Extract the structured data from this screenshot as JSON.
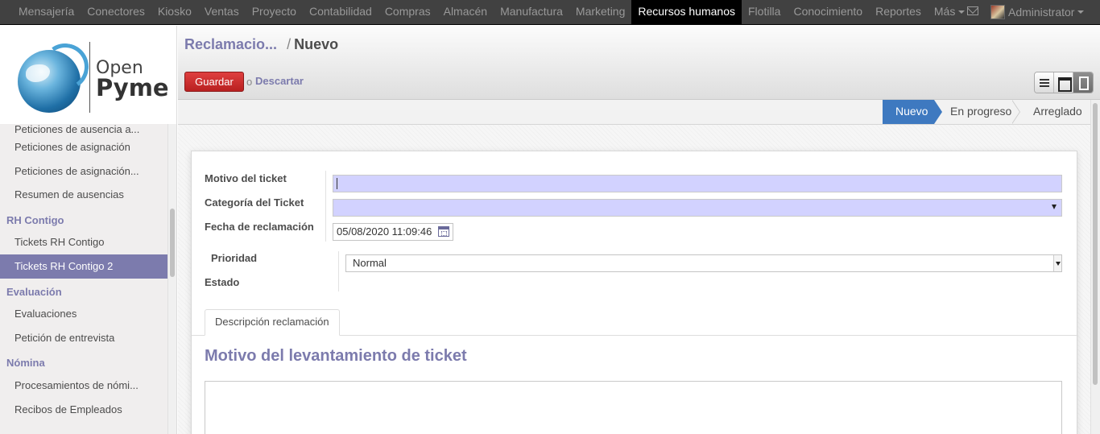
{
  "topnav": {
    "items": [
      "Mensajería",
      "Conectores",
      "Kiosko",
      "Ventas",
      "Proyecto",
      "Contabilidad",
      "Compras",
      "Almacén",
      "Manufactura",
      "Marketing",
      "Recursos humanos",
      "Flotilla",
      "Conocimiento",
      "Reportes",
      "Más"
    ],
    "active_index": 10,
    "user": "Administrator"
  },
  "logo": {
    "line1": "Open",
    "line2": "Pyme"
  },
  "sidebar": {
    "cut_item": "Peticiones de ausencia a...",
    "items_a": [
      "Peticiones de asignación",
      "Peticiones de asignación...",
      "Resumen de ausencias"
    ],
    "head_rh": "RH Contigo",
    "items_rh": [
      "Tickets RH Contigo",
      "Tickets RH Contigo 2"
    ],
    "head_eval": "Evaluación",
    "items_eval": [
      "Evaluaciones",
      "Petición de entrevista"
    ],
    "head_nomina": "Nómina",
    "items_nomina": [
      "Procesamientos de nómi...",
      "Recibos de Empleados"
    ]
  },
  "header": {
    "breadcrumb_parent": "Reclamacio...",
    "breadcrumb_sep": "/",
    "breadcrumb_current": "Nuevo",
    "save_label": "Guardar",
    "or_label": "o",
    "discard_label": "Descartar"
  },
  "stages": [
    "Nuevo",
    "En progreso",
    "Arreglado"
  ],
  "form": {
    "label_motivo": "Motivo del ticket",
    "label_categoria": "Categoría del Ticket",
    "label_fecha": "Fecha de reclamación",
    "fecha_value": "05/08/2020 11:09:46",
    "label_prioridad": "Prioridad",
    "prioridad_value": "Normal",
    "label_estado": "Estado",
    "tab_label": "Descripción reclamación",
    "section_title": "Motivo del levantamiento de ticket"
  },
  "colors": {
    "accent": "#7c7bad",
    "save": "#c62828",
    "stage_active": "#3e79c0",
    "required_bg": "#d2d2ff"
  }
}
